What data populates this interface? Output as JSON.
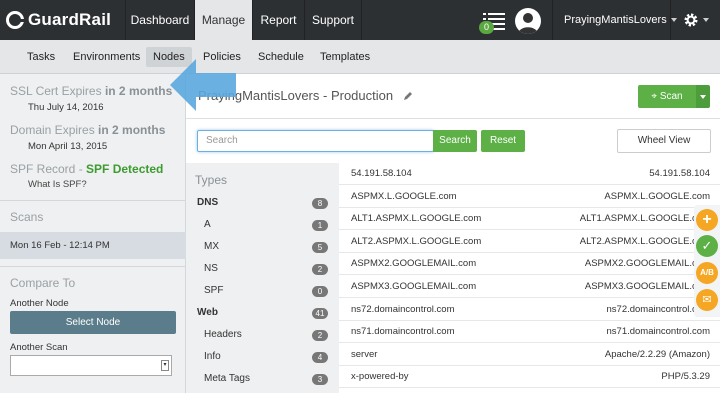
{
  "brand": {
    "name": "GuardRail"
  },
  "nav": {
    "items": [
      "Dashboard",
      "Manage",
      "Report",
      "Support"
    ],
    "active": "Manage"
  },
  "notifications": {
    "count": "0"
  },
  "user": {
    "name": "PrayingMantisLovers"
  },
  "subnav": {
    "items": [
      "Tasks",
      "Environments",
      "Nodes",
      "Policies",
      "Schedule",
      "Templates"
    ],
    "active": "Nodes"
  },
  "sidebar": {
    "ssl": {
      "label": "SSL Cert Expires",
      "value": "in 2 months",
      "date": "Thu July 14, 2016"
    },
    "domain": {
      "label": "Domain Expires",
      "value": "in 2 months",
      "date": "Mon April 13, 2015"
    },
    "spf": {
      "label": "SPF Record - ",
      "value": "SPF Detected",
      "link": "What Is SPF?"
    },
    "scans": {
      "header": "Scans",
      "selected": "Mon 16 Feb - 12:14 PM"
    },
    "compare": {
      "header": "Compare To",
      "another_node": "Another Node",
      "select_node": "Select Node",
      "another_scan": "Another Scan"
    }
  },
  "main": {
    "title": "PrayingMantisLovers - Production",
    "scan_label": "Scan",
    "search_placeholder": "Search",
    "search_button": "Search",
    "reset_button": "Reset",
    "wheel_button": "Wheel View"
  },
  "types": {
    "header": "Types",
    "items": [
      {
        "label": "DNS",
        "count": "8",
        "group": true
      },
      {
        "label": "A",
        "count": "1"
      },
      {
        "label": "MX",
        "count": "5"
      },
      {
        "label": "NS",
        "count": "2"
      },
      {
        "label": "SPF",
        "count": "0"
      },
      {
        "label": "Web",
        "count": "41",
        "group": true
      },
      {
        "label": "Headers",
        "count": "2"
      },
      {
        "label": "Info",
        "count": "4"
      },
      {
        "label": "Meta Tags",
        "count": "3"
      }
    ]
  },
  "records": [
    {
      "key": "54.191.58.104",
      "value": "54.191.58.104"
    },
    {
      "key": "ASPMX.L.GOOGLE.com",
      "value": "ASPMX.L.GOOGLE.com"
    },
    {
      "key": "ALT1.ASPMX.L.GOOGLE.com",
      "value": "ALT1.ASPMX.L.GOOGLE.com"
    },
    {
      "key": "ALT2.ASPMX.L.GOOGLE.com",
      "value": "ALT2.ASPMX.L.GOOGLE.com"
    },
    {
      "key": "ASPMX2.GOOGLEMAIL.com",
      "value": "ASPMX2.GOOGLEMAIL.com"
    },
    {
      "key": "ASPMX3.GOOGLEMAIL.com",
      "value": "ASPMX3.GOOGLEMAIL.com"
    },
    {
      "key": "ns72.domaincontrol.com",
      "value": "ns72.domaincontrol.com"
    },
    {
      "key": "ns71.domaincontrol.com",
      "value": "ns71.domaincontrol.com"
    },
    {
      "key": "server",
      "value": "Apache/2.2.29 (Amazon)"
    },
    {
      "key": "x-powered-by",
      "value": "PHP/5.3.29"
    }
  ],
  "floating": {
    "ab_label": "A/B"
  },
  "colors": {
    "green": "#5cb046",
    "dark": "#2d3033",
    "spf_ok": "#3d9b2f",
    "arrow": "#5aa9df"
  }
}
